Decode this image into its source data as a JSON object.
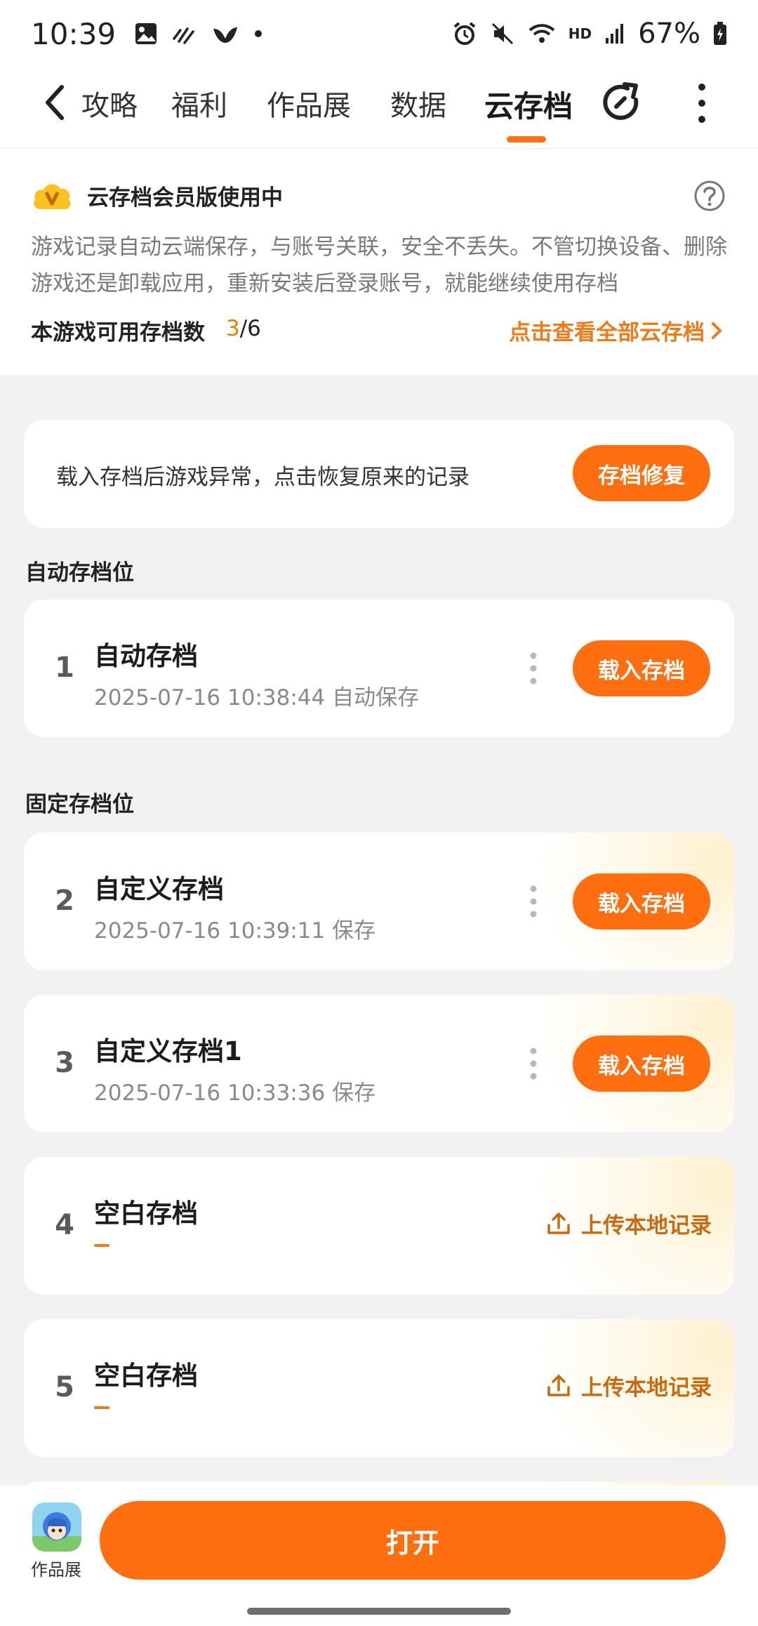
{
  "status_bar": {
    "time": "10:39",
    "network": "HD",
    "battery": "67%"
  },
  "nav": {
    "tabs": [
      "攻略",
      "福利",
      "作品展",
      "数据",
      "云存档"
    ],
    "active_tab": "云存档"
  },
  "member": {
    "title": "云存档会员版使用中",
    "description": "游戏记录自动云端保存，与账号关联，安全不丢失。不管切换设备、删除游戏还是卸载应用，重新安装后登录账号，就能继续使用存档",
    "quota_label": "本游戏可用存档数",
    "quota_used": "3",
    "quota_total": "/6",
    "view_all_label": "点击查看全部云存档"
  },
  "repair": {
    "text": "载入存档后游戏异常，点击恢复原来的记录",
    "button": "存档修复"
  },
  "sections": {
    "auto": "自动存档位",
    "fixed": "固定存档位"
  },
  "slots": [
    {
      "num": "1",
      "name": "自动存档",
      "timestamp": "2025-07-16 10:38:44 自动保存",
      "action": "载入存档"
    },
    {
      "num": "2",
      "name": "自定义存档",
      "timestamp": "2025-07-16 10:39:11 保存",
      "action": "载入存档"
    },
    {
      "num": "3",
      "name": "自定义存档1",
      "timestamp": "2025-07-16 10:33:36 保存",
      "action": "载入存档"
    },
    {
      "num": "4",
      "name": "空白存档",
      "timestamp": "",
      "action": "上传本地记录"
    },
    {
      "num": "5",
      "name": "空白存档",
      "timestamp": "",
      "action": "上传本地记录"
    }
  ],
  "bottom": {
    "avatar_label": "作品展",
    "open_button": "打开"
  },
  "colors": {
    "accent": "#ff6f0f",
    "link": "#ef7a18",
    "quota_highlight": "#e38400"
  }
}
